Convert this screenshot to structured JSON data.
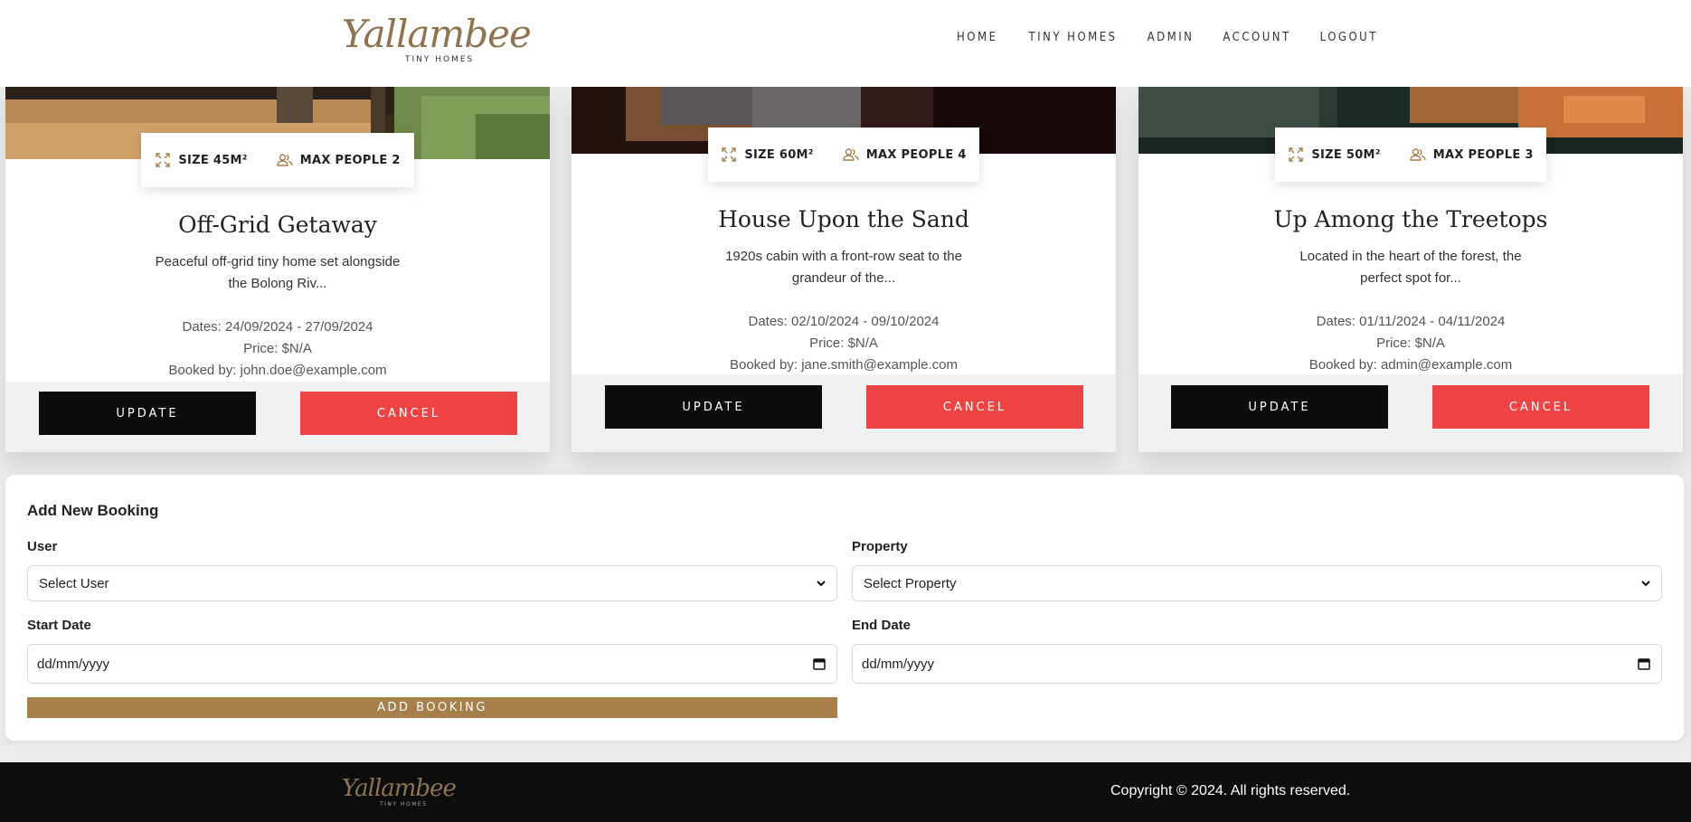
{
  "header": {
    "logo_script": "Yallambee",
    "logo_sub": "TINY HOMES",
    "nav": [
      "HOME",
      "TINY HOMES",
      "ADMIN",
      "ACCOUNT",
      "LOGOUT"
    ]
  },
  "cards": [
    {
      "size": "SIZE 45M²",
      "max_people": "MAX PEOPLE 2",
      "title": "Off-Grid Getaway",
      "description": "Peaceful off-grid tiny home set alongside the Bolong Riv...",
      "dates": "Dates: 24/09/2024 - 27/09/2024",
      "price": "Price: $N/A",
      "booked_by": "Booked by: john.doe@example.com",
      "update_label": "UPDATE",
      "cancel_label": "CANCEL"
    },
    {
      "size": "SIZE 60M²",
      "max_people": "MAX PEOPLE 4",
      "title": "House Upon the Sand",
      "description": "1920s cabin with a front-row seat to the grandeur of the...",
      "dates": "Dates: 02/10/2024 - 09/10/2024",
      "price": "Price: $N/A",
      "booked_by": "Booked by: jane.smith@example.com",
      "update_label": "UPDATE",
      "cancel_label": "CANCEL"
    },
    {
      "size": "SIZE 50M²",
      "max_people": "MAX PEOPLE 3",
      "title": "Up Among the Treetops",
      "description": "Located in the heart of the forest, the perfect spot for...",
      "dates": "Dates: 01/11/2024 - 04/11/2024",
      "price": "Price: $N/A",
      "booked_by": "Booked by: admin@example.com",
      "update_label": "UPDATE",
      "cancel_label": "CANCEL"
    }
  ],
  "form": {
    "title": "Add New Booking",
    "user_label": "User",
    "user_value": "Select User",
    "property_label": "Property",
    "property_value": "Select Property",
    "start_label": "Start Date",
    "start_value": "dd/mm/yyyy",
    "end_label": "End Date",
    "end_value": "dd/mm/yyyy",
    "submit_label": "ADD BOOKING"
  },
  "footer": {
    "logo_script": "Yallambee",
    "logo_sub": "TINY HOMES",
    "copyright": "Copyright © 2024. All rights reserved."
  },
  "colors": {
    "accent_gold": "#a67f4a",
    "cancel_red": "#ef4444",
    "dark": "#0c0c0c"
  }
}
